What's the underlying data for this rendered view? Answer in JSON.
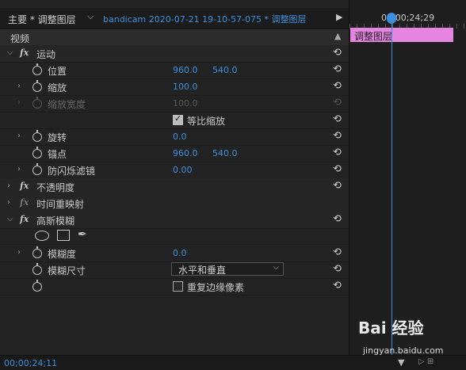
{
  "header": {
    "master_tab": "主要 * 调整图层",
    "clip_tab": "bandicam  2020-07-21  19-10-57-075 * 调整图层"
  },
  "section": {
    "label": "视频"
  },
  "effects": {
    "motion": {
      "name": "运动",
      "position": {
        "label": "位置",
        "x": "960.0",
        "y": "540.0"
      },
      "scale": {
        "label": "缩放",
        "value": "100.0"
      },
      "scale_width": {
        "label": "缩放宽度",
        "value": "100.0"
      },
      "uniform_scale": {
        "label": "等比缩放",
        "checked": true
      },
      "rotation": {
        "label": "旋转",
        "value": "0.0"
      },
      "anchor": {
        "label": "锚点",
        "x": "960.0",
        "y": "540.0"
      },
      "anti_flicker": {
        "label": "防闪烁滤镜",
        "value": "0.00"
      }
    },
    "opacity": {
      "name": "不透明度"
    },
    "time_remap": {
      "name": "时间重映射"
    },
    "gaussian_blur": {
      "name": "高斯模糊",
      "blurriness": {
        "label": "模糊度",
        "value": "0.0"
      },
      "blur_dimensions": {
        "label": "模糊尺寸",
        "value": "水平和垂直"
      },
      "repeat_edge": {
        "label": "重复边缘像素",
        "checked": false
      }
    }
  },
  "timeline": {
    "timecode": "00;00;24;29",
    "clip_label": "调整图层"
  },
  "footer": {
    "timecode": "00;00;24;11"
  },
  "watermark": {
    "brand": "Bai 经验",
    "url": "jingyan.baidu.com"
  },
  "colors": {
    "accent": "#3b8fdc",
    "clip": "#e585e0",
    "bg": "#232323"
  }
}
